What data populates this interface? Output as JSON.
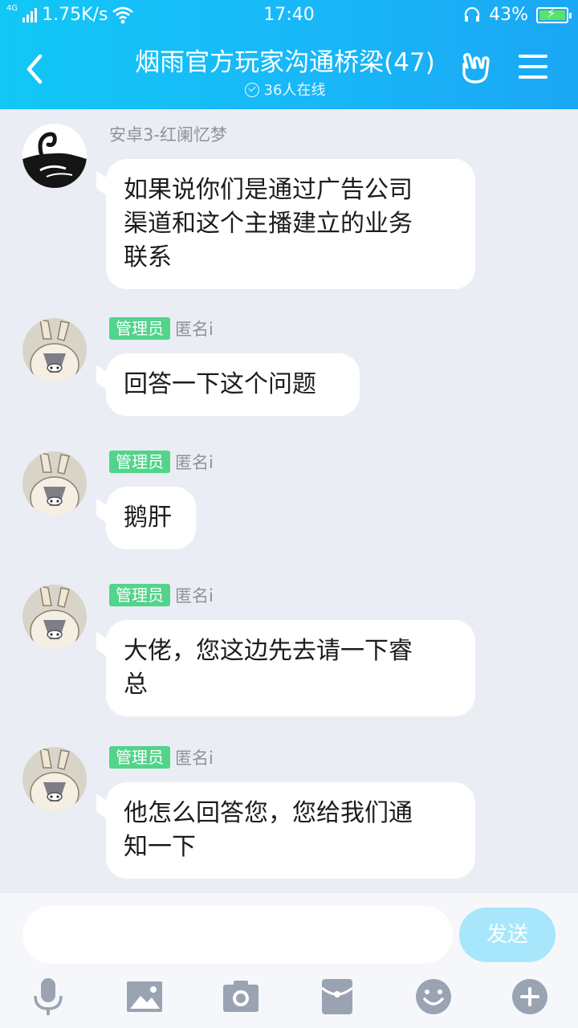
{
  "status_bar": {
    "network": "4G",
    "speed": "1.75K/s",
    "time": "17:40",
    "battery": "43%"
  },
  "header": {
    "title": "烟雨官方玩家沟通桥梁(47)",
    "online": "36人在线"
  },
  "messages": [
    {
      "sender": "安卓3-红阑忆梦",
      "badge": "",
      "text_lines": [
        "如果说你们是通过广告公司",
        "渠道和这个主播建立的业务",
        "联系"
      ]
    },
    {
      "sender": "匿名i",
      "badge": "管理员",
      "text_lines": [
        "回答一下这个问题"
      ]
    },
    {
      "sender": "匿名i",
      "badge": "管理员",
      "text_lines": [
        "鹅肝"
      ]
    },
    {
      "sender": "匿名i",
      "badge": "管理员",
      "text_lines": [
        "大佬，您这边先去请一下睿",
        "总"
      ]
    },
    {
      "sender": "匿名i",
      "badge": "管理员",
      "text_lines": [
        "他怎么回答您，您给我们通",
        "知一下"
      ]
    }
  ],
  "composer": {
    "input_value": "",
    "send_label": "发送"
  },
  "toolbar_icons": [
    "microphone-icon",
    "image-icon",
    "camera-icon",
    "red-packet-icon",
    "emoji-icon",
    "plus-icon"
  ],
  "colors": {
    "header": "#19b7f8",
    "admin_badge": "#52d48b",
    "send_button": "#a8e7fb",
    "background": "#eaedf4"
  }
}
